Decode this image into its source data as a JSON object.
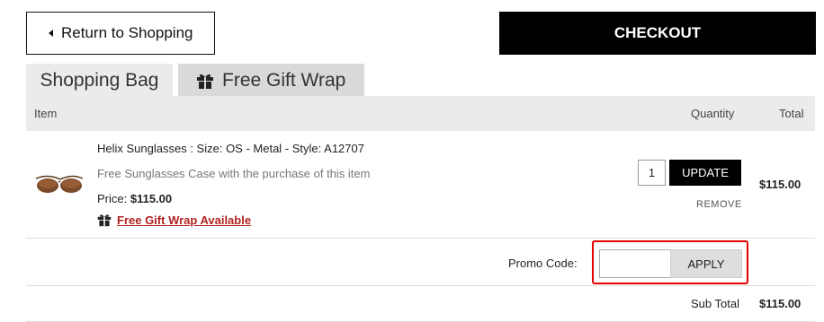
{
  "nav": {
    "return_label": "Return to Shopping",
    "checkout_label": "CHECKOUT"
  },
  "tabs": [
    {
      "label": "Shopping Bag"
    },
    {
      "label": "Free Gift Wrap"
    }
  ],
  "table": {
    "headers": {
      "item": "Item",
      "quantity": "Quantity",
      "total": "Total"
    },
    "items": [
      {
        "name": "Helix Sunglasses : Size: OS - Metal - Style: A12707",
        "promo_note": "Free Sunglasses Case with the purchase of this item",
        "price_label": "Price:",
        "price": "$115.00",
        "gift_wrap_link": "Free Gift Wrap Available",
        "quantity": "1",
        "update_label": "UPDATE",
        "remove_label": "REMOVE",
        "total": "$115.00"
      }
    ]
  },
  "promo": {
    "label": "Promo Code:",
    "value": "",
    "apply_label": "APPLY"
  },
  "summary": {
    "subtotal_label": "Sub Total",
    "subtotal_value": "$115.00"
  },
  "colors": {
    "accent": "#000000",
    "link": "#b22222",
    "highlight": "#e60000",
    "tab_bg": "#ebebeb"
  }
}
